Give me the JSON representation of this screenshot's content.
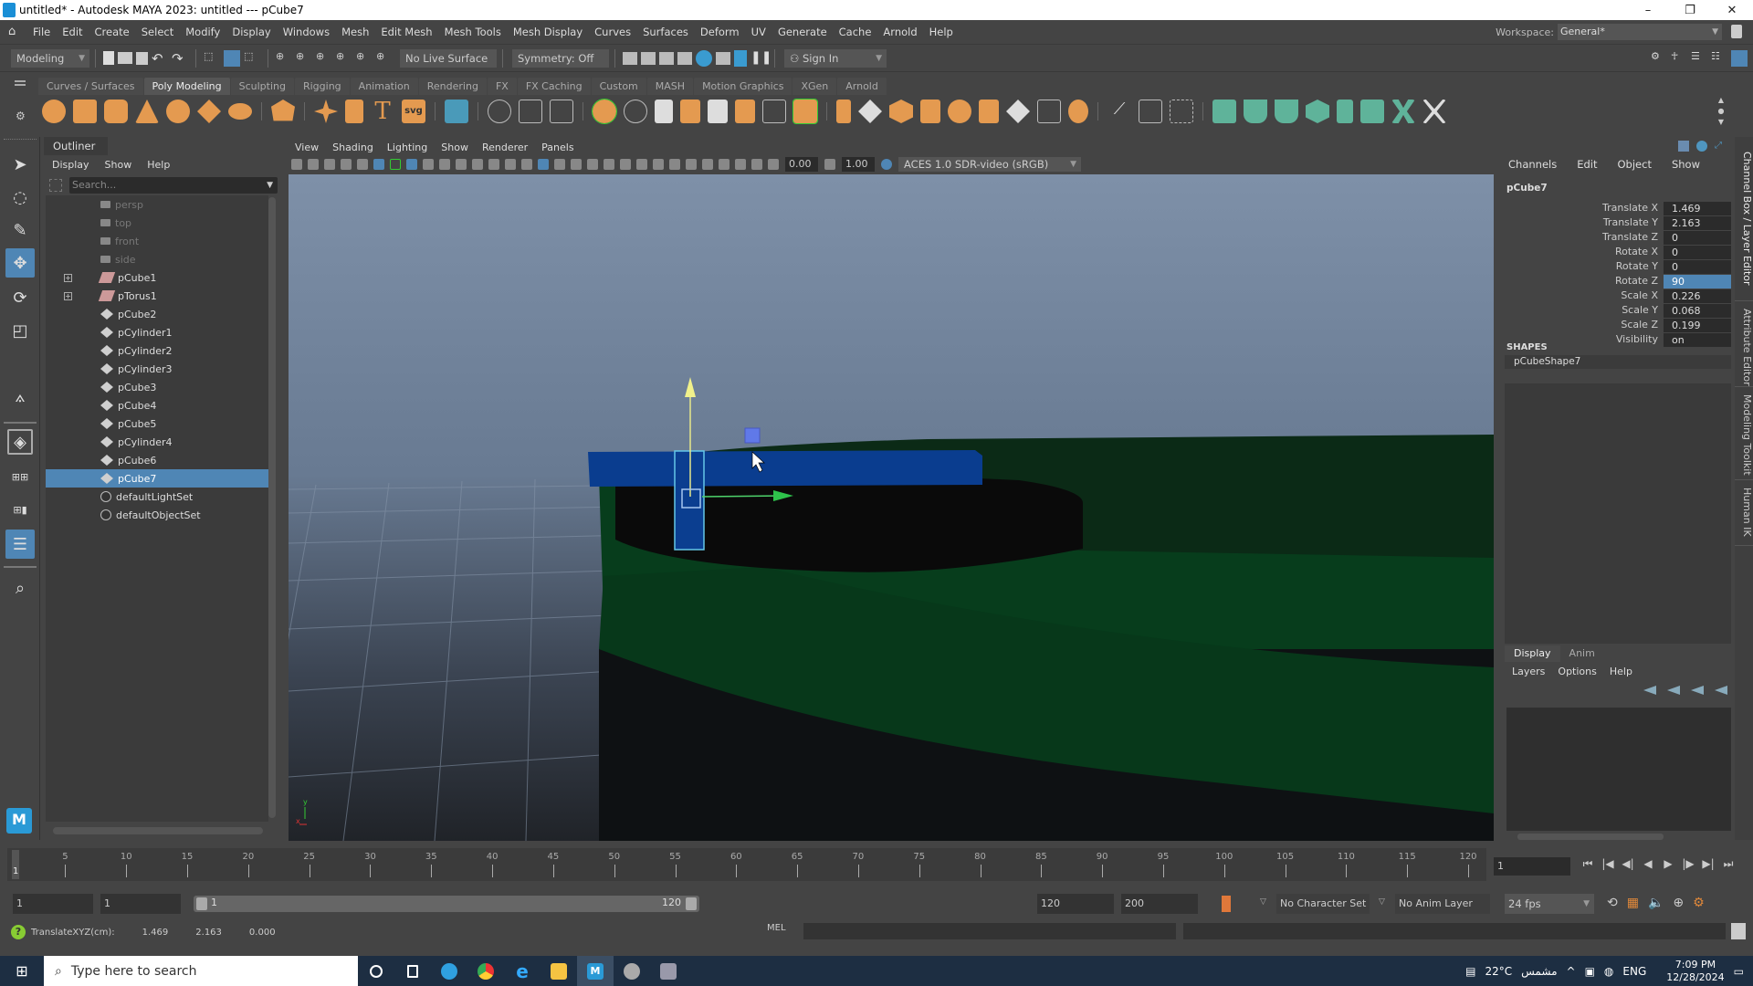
{
  "titlebar": {
    "title": "untitled* - Autodesk MAYA 2023: untitled   ---   pCube7",
    "minimize": "–",
    "maximize": "❐",
    "close": "✕"
  },
  "menubar": {
    "items": [
      "File",
      "Edit",
      "Create",
      "Select",
      "Modify",
      "Display",
      "Windows",
      "Mesh",
      "Edit Mesh",
      "Mesh Tools",
      "Mesh Display",
      "Curves",
      "Surfaces",
      "Deform",
      "UV",
      "Generate",
      "Cache",
      "Arnold",
      "Help"
    ],
    "workspace_label": "Workspace:",
    "workspace_value": "General*"
  },
  "statusline": {
    "mode": "Modeling",
    "live_surface": "No Live Surface",
    "symmetry": "Symmetry: Off",
    "sign_in": "Sign In"
  },
  "shelf": {
    "tabs": [
      "Curves / Surfaces",
      "Poly Modeling",
      "Sculpting",
      "Rigging",
      "Animation",
      "Rendering",
      "FX",
      "FX Caching",
      "Custom",
      "MASH",
      "Motion Graphics",
      "XGen",
      "Arnold"
    ],
    "active_tab": "Poly Modeling"
  },
  "outliner": {
    "title": "Outliner",
    "menu": [
      "Display",
      "Show",
      "Help"
    ],
    "search_placeholder": "Search...",
    "items": [
      {
        "name": "persp",
        "type": "camera"
      },
      {
        "name": "top",
        "type": "camera"
      },
      {
        "name": "front",
        "type": "camera"
      },
      {
        "name": "side",
        "type": "camera"
      },
      {
        "name": "pCube1",
        "type": "group",
        "expandable": true
      },
      {
        "name": "pTorus1",
        "type": "group",
        "expandable": true
      },
      {
        "name": "pCube2",
        "type": "mesh"
      },
      {
        "name": "pCylinder1",
        "type": "mesh"
      },
      {
        "name": "pCylinder2",
        "type": "mesh"
      },
      {
        "name": "pCylinder3",
        "type": "mesh"
      },
      {
        "name": "pCube3",
        "type": "mesh"
      },
      {
        "name": "pCube4",
        "type": "mesh"
      },
      {
        "name": "pCube5",
        "type": "mesh"
      },
      {
        "name": "pCylinder4",
        "type": "mesh"
      },
      {
        "name": "pCube6",
        "type": "mesh"
      },
      {
        "name": "pCube7",
        "type": "mesh",
        "selected": true
      },
      {
        "name": "defaultLightSet",
        "type": "set"
      },
      {
        "name": "defaultObjectSet",
        "type": "set"
      }
    ]
  },
  "viewport": {
    "menu": [
      "View",
      "Shading",
      "Lighting",
      "Show",
      "Renderer",
      "Panels"
    ],
    "exposure": "0.00",
    "gamma": "1.00",
    "color_space": "ACES 1.0 SDR-video (sRGB)",
    "axis_y": "y",
    "axis_x": "x"
  },
  "channelbox": {
    "menu": [
      "Channels",
      "Edit",
      "Object",
      "Show"
    ],
    "object": "pCube7",
    "channels": [
      {
        "label": "Translate X",
        "value": "1.469"
      },
      {
        "label": "Translate Y",
        "value": "2.163"
      },
      {
        "label": "Translate Z",
        "value": "0"
      },
      {
        "label": "Rotate X",
        "value": "0"
      },
      {
        "label": "Rotate Y",
        "value": "0"
      },
      {
        "label": "Rotate Z",
        "value": "90",
        "selected": true
      },
      {
        "label": "Scale X",
        "value": "0.226"
      },
      {
        "label": "Scale Y",
        "value": "0.068"
      },
      {
        "label": "Scale Z",
        "value": "0.199"
      },
      {
        "label": "Visibility",
        "value": "on"
      }
    ],
    "shapes_label": "SHAPES",
    "shape_name": "pCubeShape7"
  },
  "side_tabs": [
    "Channel Box / Layer Editor",
    "Attribute Editor",
    "Modeling Toolkit",
    "Human IK"
  ],
  "layer_editor": {
    "tabs": [
      "Display",
      "Anim"
    ],
    "active_tab": "Display",
    "menu": [
      "Layers",
      "Options",
      "Help"
    ]
  },
  "timeline": {
    "ticks": [
      5,
      10,
      15,
      20,
      25,
      30,
      35,
      40,
      45,
      50,
      55,
      60,
      65,
      70,
      75,
      80,
      85,
      90,
      95,
      100,
      105,
      110,
      115,
      120
    ],
    "start": 1,
    "end": 120,
    "current_frame": "1",
    "playhead_label": "1"
  },
  "range": {
    "start_field": "1",
    "playback_start": "1",
    "slider_start": "1",
    "slider_end": "120",
    "playback_end": "120",
    "anim_end": "200",
    "character_set": "No Character Set",
    "anim_layer": "No Anim Layer",
    "fps": "24 fps"
  },
  "helpline": {
    "label": "TranslateXYZ(cm):",
    "x": "1.469",
    "y": "2.163",
    "z": "0.000",
    "mel": "MEL"
  },
  "taskbar": {
    "search_placeholder": "Type here to search",
    "weather": "22°C",
    "weather_desc": "مشمس",
    "lang": "ENG",
    "time": "7:09 PM",
    "date": "12/28/2024"
  }
}
